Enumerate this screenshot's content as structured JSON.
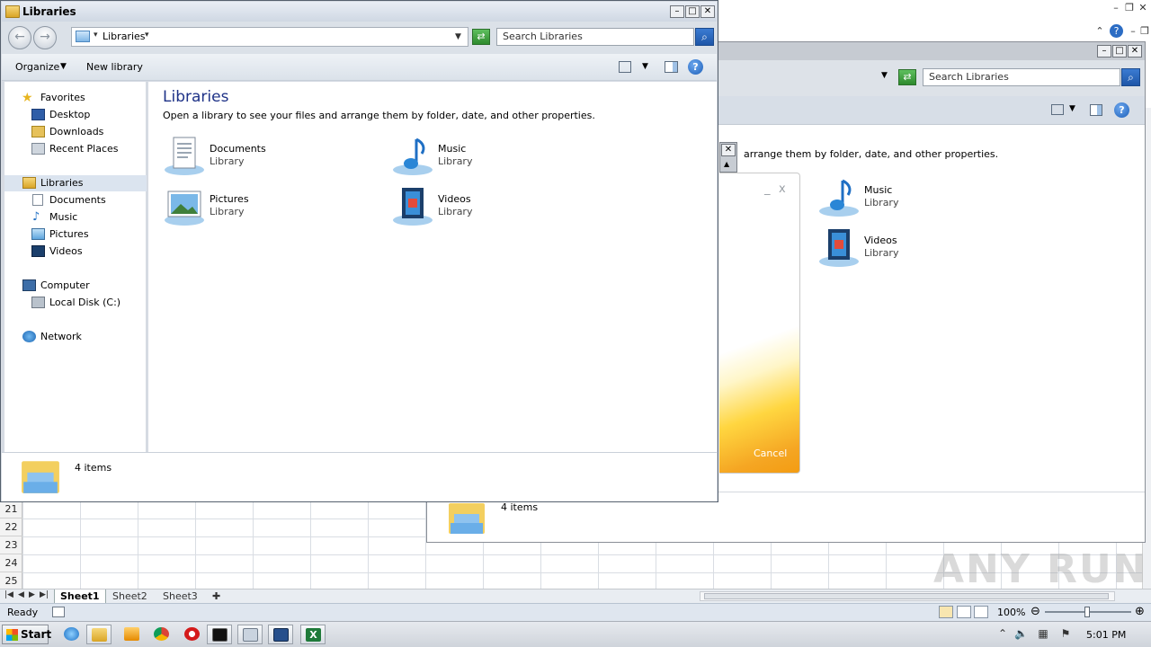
{
  "excel": {
    "row_numbers": [
      "21",
      "22",
      "23",
      "24",
      "25"
    ],
    "sheet_tabs": [
      "Sheet1",
      "Sheet2",
      "Sheet3"
    ],
    "status": "Ready",
    "zoom": "100%"
  },
  "bg_explorer": {
    "search_placeholder": "Search Libraries",
    "desc_partial": "arrange them by folder, date, and other properties.",
    "libraries": [
      {
        "name": "Music",
        "sub": "Library"
      },
      {
        "name": "Videos",
        "sub": "Library"
      }
    ],
    "footer_count": "4 items"
  },
  "dialog": {
    "minimize": "_",
    "close": "x",
    "cancel_label": "Cancel"
  },
  "explorer": {
    "title": "Libraries",
    "breadcrumb": "Libraries",
    "search_placeholder": "Search Libraries",
    "toolbar": {
      "organize": "Organize",
      "new_library": "New library"
    },
    "nav": {
      "favorites": "Favorites",
      "desktop": "Desktop",
      "downloads": "Downloads",
      "recent": "Recent Places",
      "libraries": "Libraries",
      "documents": "Documents",
      "music": "Music",
      "pictures": "Pictures",
      "videos": "Videos",
      "computer": "Computer",
      "local_disk": "Local Disk (C:)",
      "network": "Network"
    },
    "heading": "Libraries",
    "description": "Open a library to see your files and arrange them by folder, date, and other properties.",
    "libraries": [
      {
        "name": "Documents",
        "sub": "Library"
      },
      {
        "name": "Music",
        "sub": "Library"
      },
      {
        "name": "Pictures",
        "sub": "Library"
      },
      {
        "name": "Videos",
        "sub": "Library"
      }
    ],
    "details_count": "4 items"
  },
  "taskbar": {
    "start": "Start",
    "clock": "5:01 PM"
  },
  "watermark": "ANY RUN"
}
